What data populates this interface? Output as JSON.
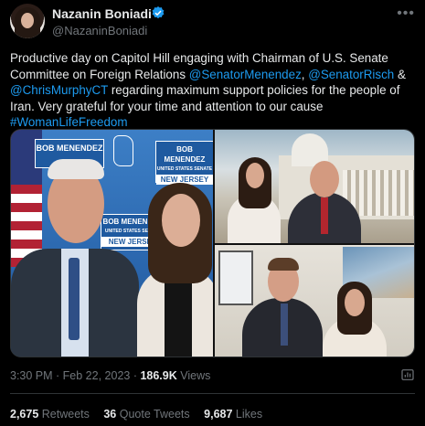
{
  "author": {
    "name": "Nazanin Boniadi",
    "handle": "@NazaninBoniadi",
    "verified": true
  },
  "tweet": {
    "text_parts": [
      "Productive day on Capitol Hill engaging with Chairman of U.S. Senate Committee on Foreign Relations ",
      "@SenatorMenendez",
      ", ",
      "@SenatorRisch",
      " & ",
      "@ChrisMurphyCT",
      " regarding maximum support policies for the people of Iran. Very grateful for your time and attention to our cause ",
      "#WomanLifeFreedom"
    ]
  },
  "media": {
    "banner_top_left": "BOB MENENDEZ",
    "banner_top_right_line1": "BOB MENENDEZ",
    "banner_top_right_line2": "UNITED STATES SENATE",
    "banner_top_right_line3": "NEW JERSEY",
    "banner_mid_line1": "BOB MENENDEZ",
    "banner_mid_line2": "UNITED STATES SENATE",
    "banner_mid_line3": "NEW JERSEY"
  },
  "meta": {
    "time": "3:30 PM",
    "separator": " · ",
    "date": "Feb 22, 2023",
    "views_count": "186.9K",
    "views_label": "Views"
  },
  "stats": {
    "retweets_count": "2,675",
    "retweets_label": "Retweets",
    "quotes_count": "36",
    "quotes_label": "Quote Tweets",
    "likes_count": "9,687",
    "likes_label": "Likes"
  },
  "colors": {
    "background": "#000000",
    "text": "#e7e9ea",
    "secondary": "#71767b",
    "link": "#1d9bf0"
  },
  "icons": [
    "verified-badge-icon",
    "more-icon",
    "analytics-icon"
  ]
}
